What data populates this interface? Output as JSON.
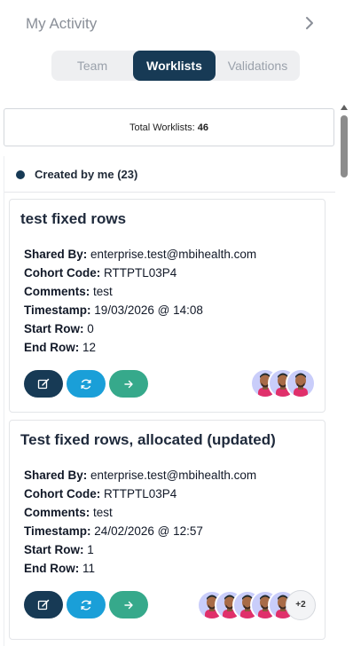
{
  "header": {
    "title": "My Activity",
    "chevron_icon": "chevron-right-icon"
  },
  "tabs": [
    {
      "label": "Team",
      "active": false
    },
    {
      "label": "Worklists",
      "active": true
    },
    {
      "label": "Validations",
      "active": false
    }
  ],
  "summary": {
    "label": "Total Worklists:",
    "count": "46"
  },
  "section": {
    "title": "Created by me (23)"
  },
  "labels": {
    "shared_by": "Shared By:",
    "cohort_code": "Cohort Code:",
    "comments": "Comments:",
    "timestamp": "Timestamp:",
    "start_row": "Start Row:",
    "end_row": "End Row:"
  },
  "worklists": [
    {
      "title": "test fixed rows",
      "shared_by": "enterprise.test@mbihealth.com",
      "cohort_code": "RTTPTL03P4",
      "comments": "test",
      "timestamp": "19/03/2026 @ 14:08",
      "start_row": "0",
      "end_row": "12",
      "avatar_count": 3,
      "more": ""
    },
    {
      "title": "Test fixed rows, allocated (updated)",
      "shared_by": "enterprise.test@mbihealth.com",
      "cohort_code": "RTTPTL03P4",
      "comments": "test",
      "timestamp": "24/02/2026 @ 12:57",
      "start_row": "1",
      "end_row": "11",
      "avatar_count": 5,
      "more": "+2"
    }
  ],
  "colors": {
    "primary": "#173a55",
    "refresh": "#1a9fd8",
    "go": "#36a98b",
    "avatar_bg": "#c9cdfa",
    "avatar_shirt": "#e0306b"
  },
  "icons": {
    "edit": "edit-icon",
    "refresh": "refresh-icon",
    "go": "arrow-right-icon"
  }
}
